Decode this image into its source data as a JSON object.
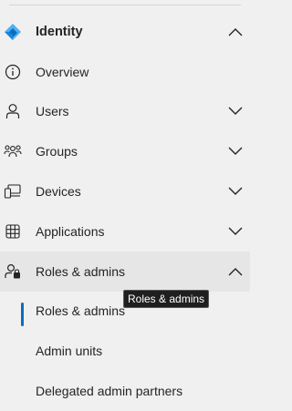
{
  "nav": {
    "header": {
      "label": "Identity",
      "icon": "identity-diamond-icon",
      "expanded": true
    },
    "items": [
      {
        "label": "Overview",
        "icon": "info-circle-icon",
        "has_chevron": false
      },
      {
        "label": "Users",
        "icon": "person-icon",
        "has_chevron": true,
        "expanded": false
      },
      {
        "label": "Groups",
        "icon": "people-team-icon",
        "has_chevron": true,
        "expanded": false
      },
      {
        "label": "Devices",
        "icon": "devices-icon",
        "has_chevron": true,
        "expanded": false
      },
      {
        "label": "Applications",
        "icon": "apps-grid-icon",
        "has_chevron": true,
        "expanded": false
      },
      {
        "label": "Roles & admins",
        "icon": "person-key-icon",
        "has_chevron": true,
        "expanded": true,
        "hovered": true
      }
    ],
    "subitems": [
      {
        "label": "Roles & admins",
        "selected": true
      },
      {
        "label": "Admin units",
        "selected": false
      },
      {
        "label": "Delegated admin partners",
        "selected": false
      }
    ]
  },
  "tooltip": {
    "text": "Roles & admins"
  },
  "colors": {
    "background": "#f0f0f0",
    "hover_background": "#e6e6e6",
    "accent": "#0f6cbd",
    "identity_icon_light": "#50b0f0",
    "identity_icon_dark": "#0f6cbd",
    "tooltip_background": "#1f1f1f"
  }
}
